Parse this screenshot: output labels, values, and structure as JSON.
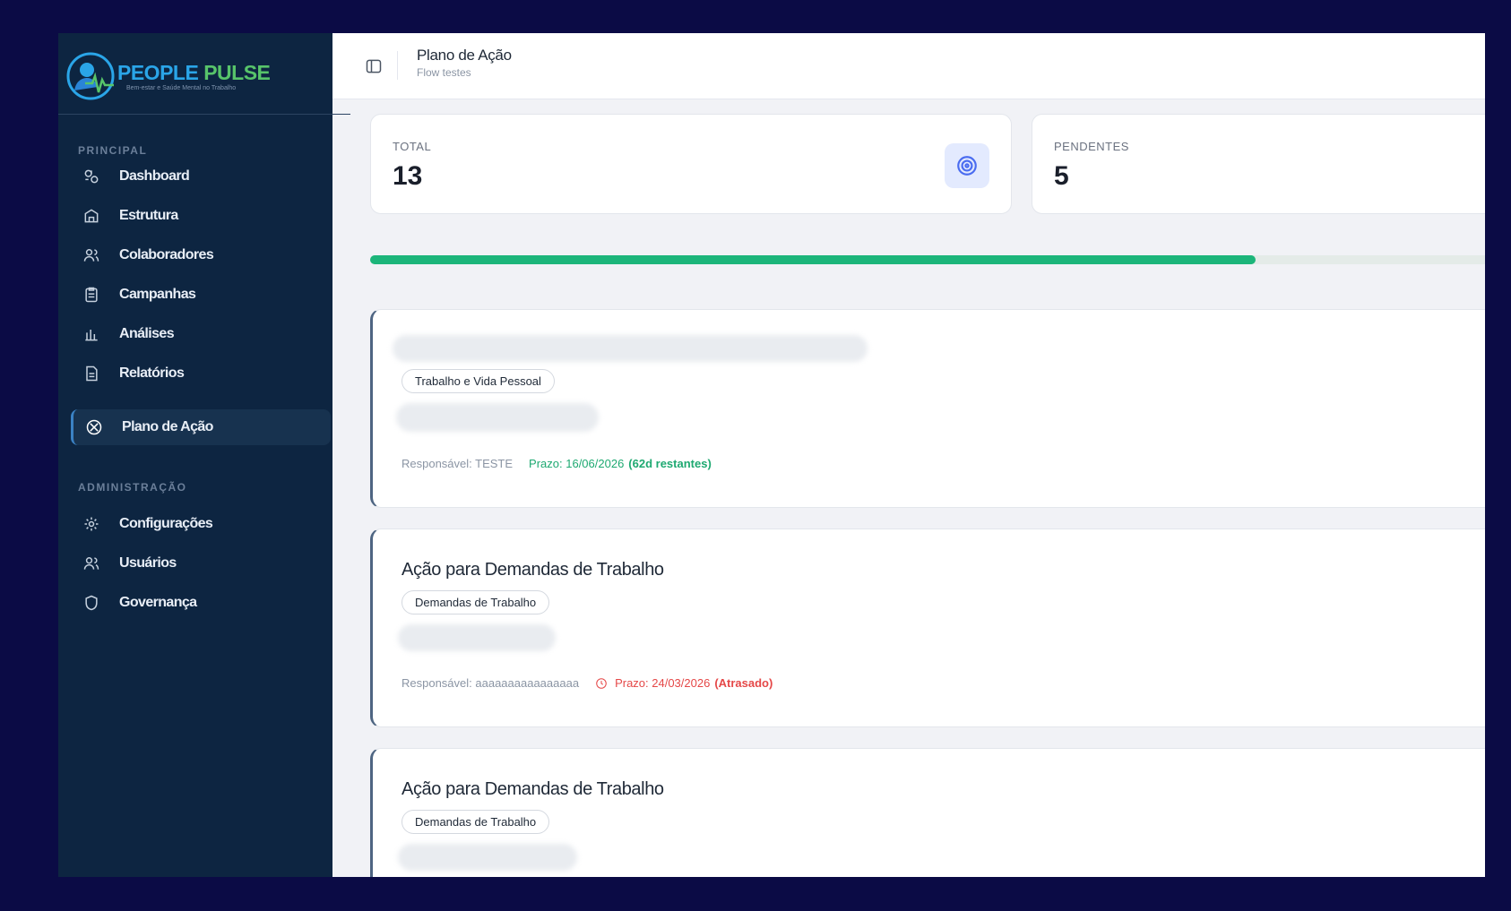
{
  "brand": {
    "name_part1": "PEOPLE",
    "name_part2": "PULSE",
    "tagline": "Bem-estar e Saúde Mental no Trabalho"
  },
  "sidebar": {
    "section_principal": "PRINCIPAL",
    "section_admin": "ADMINISTRAÇÃO",
    "items": [
      {
        "label": "Dashboard",
        "icon": "dashboard-icon"
      },
      {
        "label": "Estrutura",
        "icon": "structure-icon"
      },
      {
        "label": "Colaboradores",
        "icon": "users-icon"
      },
      {
        "label": "Campanhas",
        "icon": "clipboard-icon"
      },
      {
        "label": "Análises",
        "icon": "bar-chart-icon"
      },
      {
        "label": "Relatórios",
        "icon": "document-icon"
      },
      {
        "label": "Plano de Ação",
        "icon": "target-icon",
        "active": true
      }
    ],
    "admin_items": [
      {
        "label": "Configurações",
        "icon": "gear-icon"
      },
      {
        "label": "Usuários",
        "icon": "users-icon"
      },
      {
        "label": "Governança",
        "icon": "shield-icon"
      }
    ]
  },
  "header": {
    "title": "Plano de Ação",
    "subtitle": "Flow testes"
  },
  "stats": {
    "total_label": "TOTAL",
    "total_value": "13",
    "pending_label": "PENDENTES",
    "pending_value": "5"
  },
  "progress": {
    "fraction": 0.76
  },
  "actions": [
    {
      "title": "",
      "tag": "Trabalho e Vida Pessoal",
      "responsible": "Responsável: TESTE",
      "due": "Prazo: 16/06/2026",
      "due_status": "(62d restantes)",
      "late": false
    },
    {
      "title": "Ação para Demandas de Trabalho",
      "tag": "Demandas de Trabalho",
      "responsible": "Responsável: aaaaaaaaaaaaaaaa",
      "due": "Prazo: 24/03/2026",
      "due_status": "(Atrasado)",
      "late": true
    },
    {
      "title": "Ação para Demandas de Trabalho",
      "tag": "Demandas de Trabalho"
    }
  ],
  "colors": {
    "sidebar_bg": "#0d2541",
    "accent_blue": "#2aa5e8",
    "accent_green": "#57c46a",
    "progress": "#1cb57a",
    "danger": "#e54848"
  }
}
